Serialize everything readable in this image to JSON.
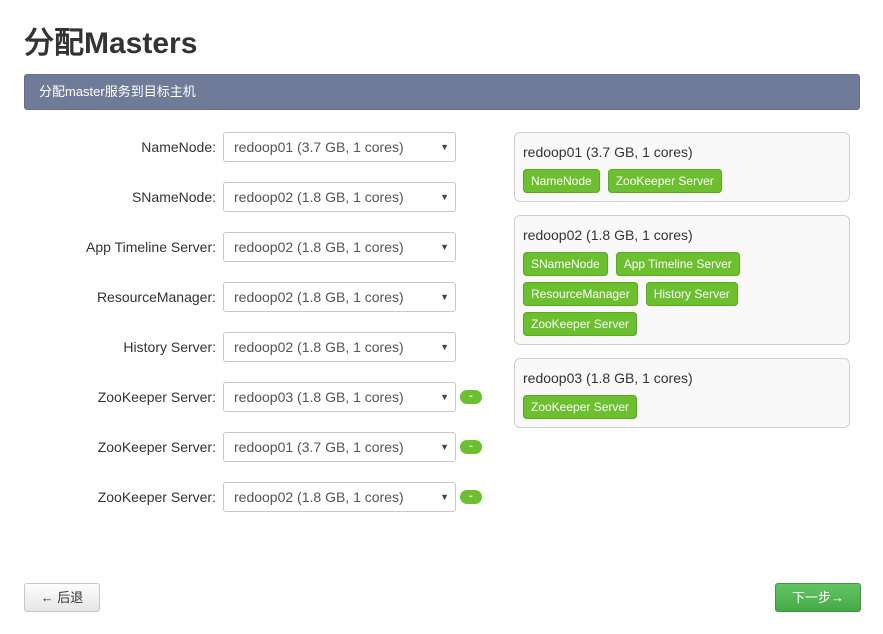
{
  "header": {
    "title": "分配Masters",
    "banner": "分配master服务到目标主机"
  },
  "assignments": [
    {
      "label": "NameNode:",
      "value": "redoop01 (3.7 GB, 1 cores)",
      "removable": false
    },
    {
      "label": "SNameNode:",
      "value": "redoop02 (1.8 GB, 1 cores)",
      "removable": false
    },
    {
      "label": "App Timeline Server:",
      "value": "redoop02 (1.8 GB, 1 cores)",
      "removable": false
    },
    {
      "label": "ResourceManager:",
      "value": "redoop02 (1.8 GB, 1 cores)",
      "removable": false
    },
    {
      "label": "History Server:",
      "value": "redoop02 (1.8 GB, 1 cores)",
      "removable": false
    },
    {
      "label": "ZooKeeper Server:",
      "value": "redoop03 (1.8 GB, 1 cores)",
      "removable": true
    },
    {
      "label": "ZooKeeper Server:",
      "value": "redoop01 (3.7 GB, 1 cores)",
      "removable": true
    },
    {
      "label": "ZooKeeper Server:",
      "value": "redoop02 (1.8 GB, 1 cores)",
      "removable": true
    }
  ],
  "remove_label": "-",
  "hosts": [
    {
      "name": "redoop01 (3.7 GB, 1 cores)",
      "components": [
        "NameNode",
        "ZooKeeper Server"
      ]
    },
    {
      "name": "redoop02 (1.8 GB, 1 cores)",
      "components": [
        "SNameNode",
        "App Timeline Server",
        "ResourceManager",
        "History Server",
        "ZooKeeper Server"
      ]
    },
    {
      "name": "redoop03 (1.8 GB, 1 cores)",
      "components": [
        "ZooKeeper Server"
      ]
    }
  ],
  "footer": {
    "back_label": "← 后退",
    "next_label": "下一步→"
  },
  "colors": {
    "banner": "#6f7b99",
    "component_chip": "#6cbf2f",
    "next_button": "#5cb85c"
  }
}
